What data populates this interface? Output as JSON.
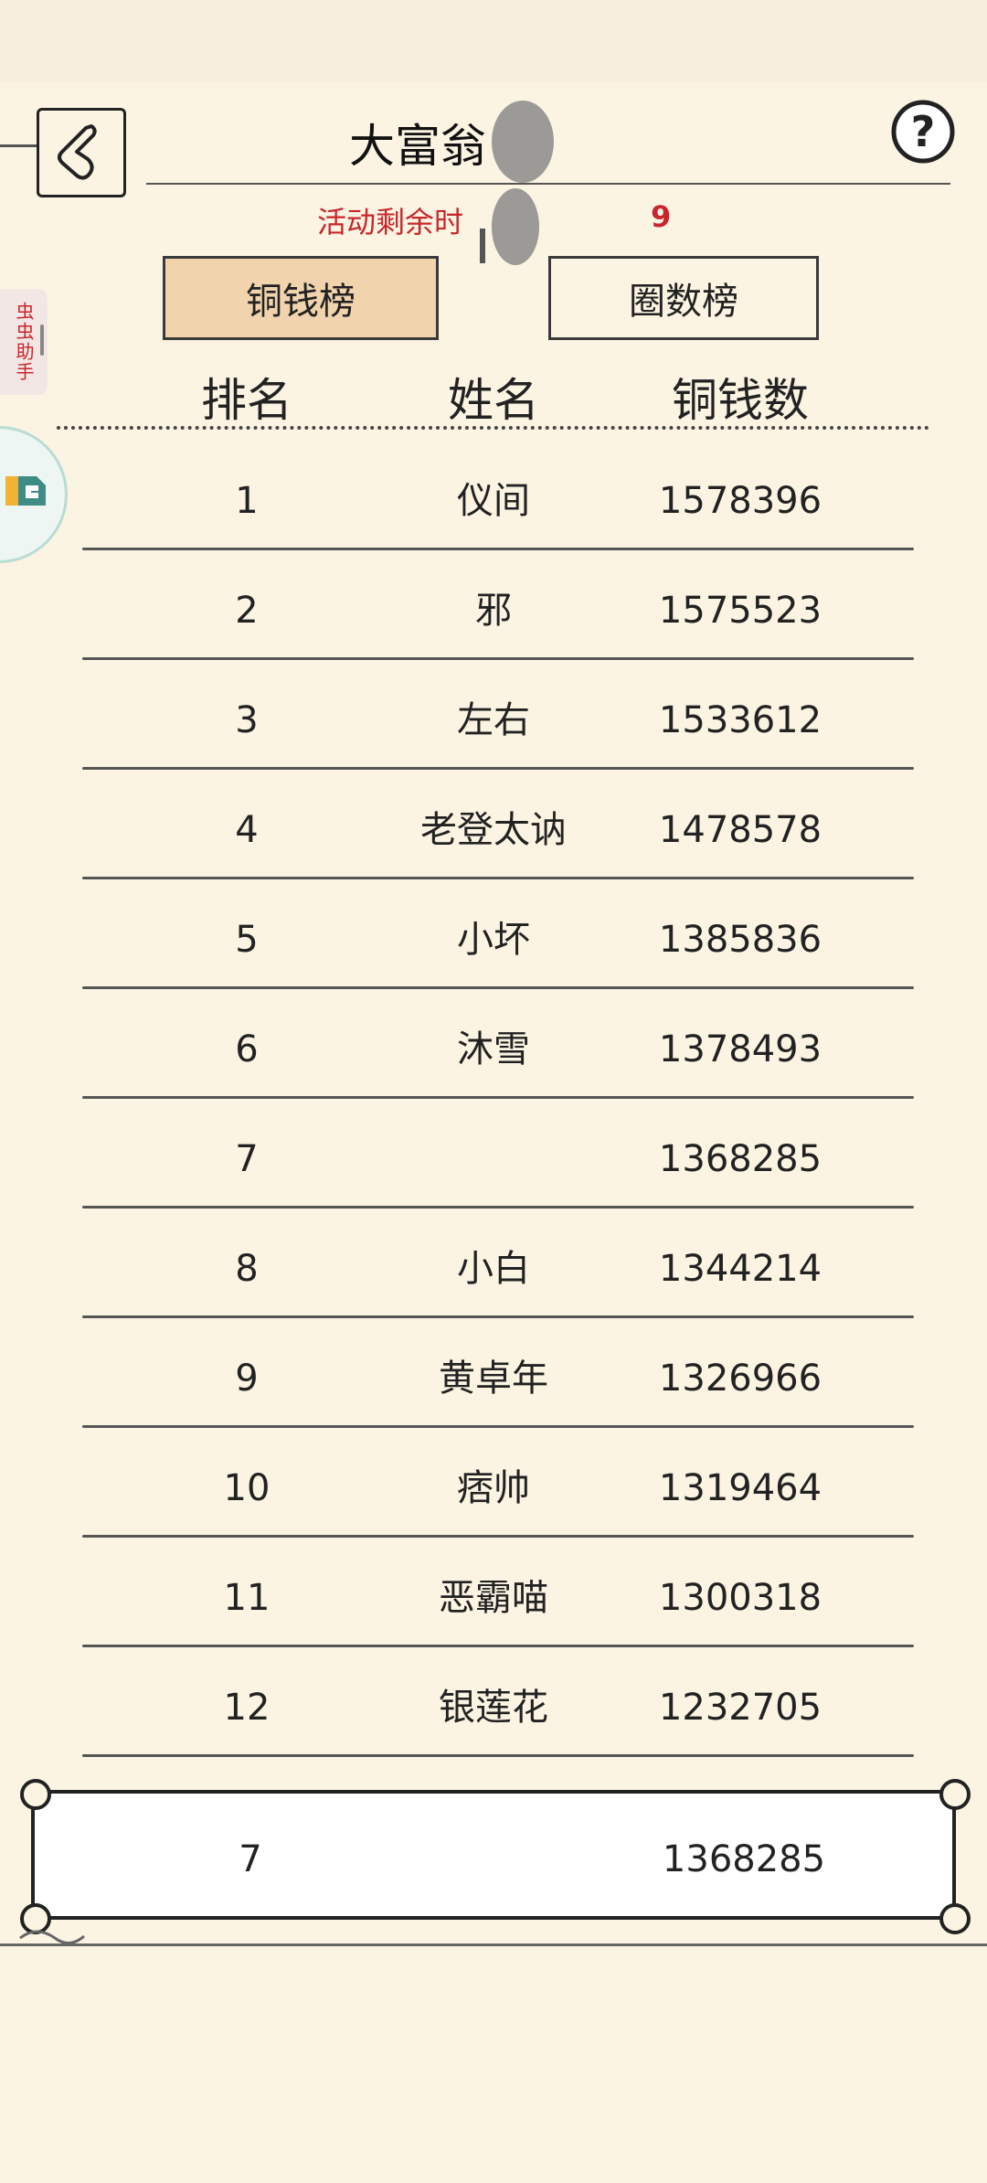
{
  "header": {
    "title": "大富翁",
    "timer_label": "活动剩余时",
    "timer_value": "9"
  },
  "tabs": [
    {
      "label": "铜钱榜",
      "active": true
    },
    {
      "label": "圈数榜",
      "active": false
    }
  ],
  "side_helper": {
    "label": "虫虫助手"
  },
  "table": {
    "columns": [
      "排名",
      "姓名",
      "铜钱数"
    ],
    "rows": [
      {
        "rank": "1",
        "name": "仪间",
        "coins": "1578396"
      },
      {
        "rank": "2",
        "name": "邪",
        "coins": "1575523"
      },
      {
        "rank": "3",
        "name": "左右",
        "coins": "1533612"
      },
      {
        "rank": "4",
        "name": "老登太讷",
        "coins": "1478578"
      },
      {
        "rank": "5",
        "name": "小坏",
        "coins": "1385836"
      },
      {
        "rank": "6",
        "name": "沐雪",
        "coins": "1378493"
      },
      {
        "rank": "7",
        "name": "",
        "coins": "1368285"
      },
      {
        "rank": "8",
        "name": "小白",
        "coins": "1344214"
      },
      {
        "rank": "9",
        "name": "黄卓年",
        "coins": "1326966"
      },
      {
        "rank": "10",
        "name": "痞帅",
        "coins": "1319464"
      },
      {
        "rank": "11",
        "name": "恶霸喵",
        "coins": "1300318"
      },
      {
        "rank": "12",
        "name": "银莲花",
        "coins": "1232705"
      }
    ]
  },
  "my_rank": {
    "rank": "7",
    "name": "",
    "coins": "1368285"
  },
  "colors": {
    "background": "#fbf4e3",
    "active_tab": "#f1d3ae",
    "timer_red": "#c8262a"
  }
}
